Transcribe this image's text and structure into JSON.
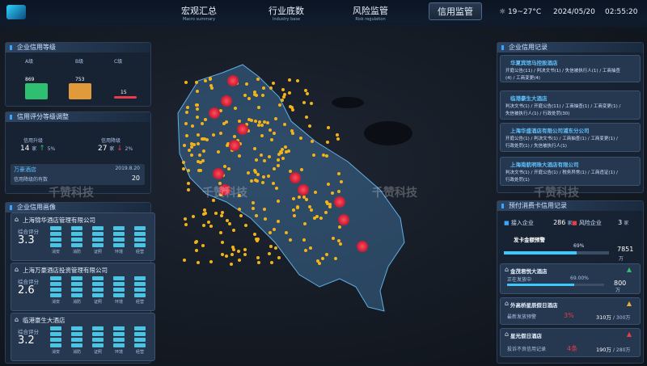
{
  "header": {
    "nav": [
      {
        "label": "宏观汇总",
        "sub": "Macro summary"
      },
      {
        "label": "行业底数",
        "sub": "Industry base"
      },
      {
        "label": "风险监管",
        "sub": "Risk regulation"
      },
      {
        "label": "信用监管",
        "sub": ""
      }
    ],
    "weather": "19~27°C",
    "date": "2024/05/20",
    "time": "02:55:20"
  },
  "left": {
    "p1": {
      "title": "企业信用等级",
      "levels": [
        "A级",
        "B级",
        "C级"
      ],
      "values": [
        "869",
        "753",
        "15"
      ]
    },
    "p2": {
      "title": "信用评分等级调整",
      "up_label": "信用升级",
      "up_value": "14",
      "up_unit": "家",
      "up_pct": "5%",
      "down_label": "信用降级",
      "down_value": "27",
      "down_unit": "家",
      "down_pct": "2%",
      "hotel": "万豪酒店",
      "hotel_date": "2019.8.20",
      "hotel_desc": "信用降级的有数",
      "hotel_num": "20"
    },
    "p3": {
      "title": "企业信用画像",
      "score_label": "综合评分",
      "gauge_labels": [
        "消安",
        "消防",
        "证照",
        "环境",
        "经营"
      ],
      "companies": [
        {
          "name": "上海锦华酒店管理有限公司",
          "score": "3.3"
        },
        {
          "name": "上海万豪酒店投资管理有限公司",
          "score": "2.6"
        },
        {
          "name": "临港豪生大酒店",
          "score": "3.2"
        }
      ]
    }
  },
  "right": {
    "p1": {
      "title": "企业信用记录",
      "records": [
        {
          "name": "华夏宾馆马控股酒店",
          "lines": [
            "开庭公告(11) / 判决文书(1) / 失信被执行人(1) / 工商抽查",
            "(4) / 工商变更(4)"
          ]
        },
        {
          "name": "临港豪生大酒店",
          "lines": [
            "判决文书(1) / 开庭公告(11) / 工商抽查(1) / 工商变更(1) /",
            "失信被执行人(1) / 行政处罚(30)"
          ]
        },
        {
          "name": "上海华盛酒店有限公司浦东分公司",
          "lines": [
            "开庭公告(1) / 判决文书(1) / 工商抽查(1) / 工商变更(1) /",
            "行政处罚(1) / 失信被执行人(1)"
          ]
        },
        {
          "name": "上海南航明珠大酒店有限公司",
          "lines": [
            "判决文书(1) / 开庭公告(1) / 税务异常(1) / 工商违证(1) /",
            "行政处罚(1)"
          ]
        }
      ]
    },
    "p2": {
      "title": "预付消费卡信用记录",
      "join_label": "接入企业",
      "join_value": "286",
      "join_unit": "家",
      "risk_label": "风险企业",
      "risk_value": "3",
      "risk_unit": "家",
      "warn_label": "发卡金额预警",
      "pct": "69%",
      "amount": "7851",
      "amount_unit": "万",
      "cards": [
        {
          "name": "金茂君悦大酒店",
          "sub": "正在发放中",
          "pct": "69.00%",
          "value": "800",
          "unit": "万"
        },
        {
          "name": "外高桥星辰假日酒店",
          "sub": "最新发放预警",
          "pct": "3%",
          "value": "310万",
          "total": "/ 300万"
        },
        {
          "name": "星光假日酒店",
          "sub": "投诉不良信用记录",
          "pct": "4条",
          "value": "190万",
          "total": "/ 280万"
        }
      ]
    }
  },
  "watermark": "千赞科技",
  "colors": {
    "accent": "#38a6ff",
    "green": "#2fbf71",
    "orange": "#e09a3c",
    "red": "#e83b4b"
  }
}
